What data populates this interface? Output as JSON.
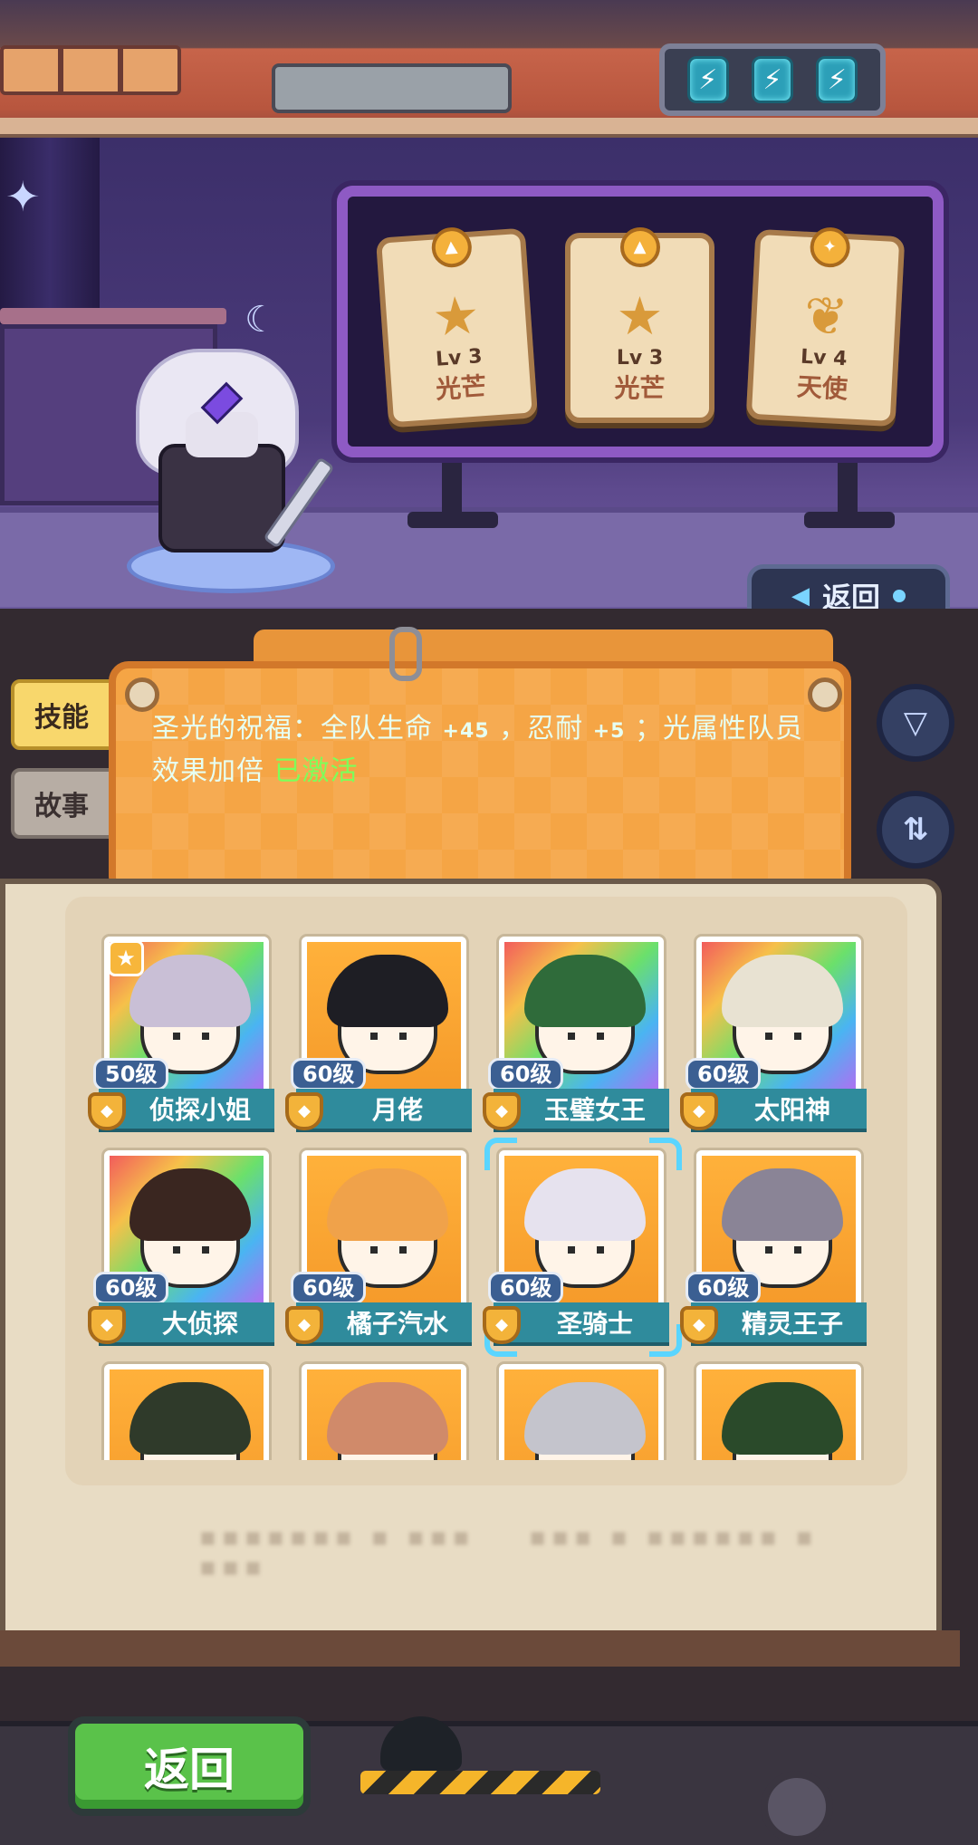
{
  "energy": {
    "cells": [
      "⚡",
      "⚡",
      "⚡"
    ]
  },
  "skill_cards": [
    {
      "level": "Lv 3",
      "name": "光芒",
      "icon": "star-burst-icon"
    },
    {
      "level": "Lv 3",
      "name": "光芒",
      "icon": "star-burst-icon"
    },
    {
      "level": "Lv 4",
      "name": "天使",
      "icon": "angel-wings-icon"
    }
  ],
  "header": {
    "back_label": "返回"
  },
  "tabs": [
    {
      "label": "技能",
      "active": true
    },
    {
      "label": "故事",
      "active": false
    }
  ],
  "skill_description": {
    "part1": "圣光的祝福：全队生命 ",
    "num1": "+45",
    "part2": " ，忍耐 ",
    "num2": "+5",
    "part3": " ；光属性队员效果加倍 ",
    "status": "已激活"
  },
  "side_buttons": {
    "filter_icon": "▽",
    "sort_icon": "⇅"
  },
  "heroes": [
    {
      "level": "50级",
      "name": "侦探小姐",
      "bg": "rainbow",
      "hair": "#c9bfd6",
      "starred": true
    },
    {
      "level": "60级",
      "name": "月佬",
      "bg": "gold",
      "hair": "#1e1e24",
      "starred": false
    },
    {
      "level": "60级",
      "name": "玉璧女王",
      "bg": "rainbow",
      "hair": "#2f6b3a",
      "starred": false
    },
    {
      "level": "60级",
      "name": "太阳神",
      "bg": "rainbow",
      "hair": "#e8e2d2",
      "starred": false
    },
    {
      "level": "60级",
      "name": "大侦探",
      "bg": "rainbow",
      "hair": "#3a2620",
      "starred": false
    },
    {
      "level": "60级",
      "name": "橘子汽水",
      "bg": "gold",
      "hair": "#f0a24a",
      "starred": false
    },
    {
      "level": "60级",
      "name": "圣骑士",
      "bg": "gold",
      "hair": "#e6e2ee",
      "starred": false,
      "selected": true
    },
    {
      "level": "60级",
      "name": "精灵王子",
      "bg": "gold",
      "hair": "#8a8496",
      "starred": false
    },
    {
      "level": "",
      "name": "",
      "bg": "gold",
      "hair": "#2f3a2a",
      "starred": false
    },
    {
      "level": "",
      "name": "",
      "bg": "gold",
      "hair": "#d08a6a",
      "starred": false
    },
    {
      "level": "",
      "name": "",
      "bg": "gold",
      "hair": "#c4c4cc",
      "starred": false
    },
    {
      "level": "",
      "name": "",
      "bg": "gold",
      "hair": "#2a4a2a",
      "starred": false
    }
  ],
  "footer": {
    "back_label": "返回"
  },
  "colors": {
    "accent_teal": "#2f8b9c",
    "level_blue": "#3b5f92",
    "active_green": "#7dff5a",
    "board_purple": "#8e5ac4"
  }
}
